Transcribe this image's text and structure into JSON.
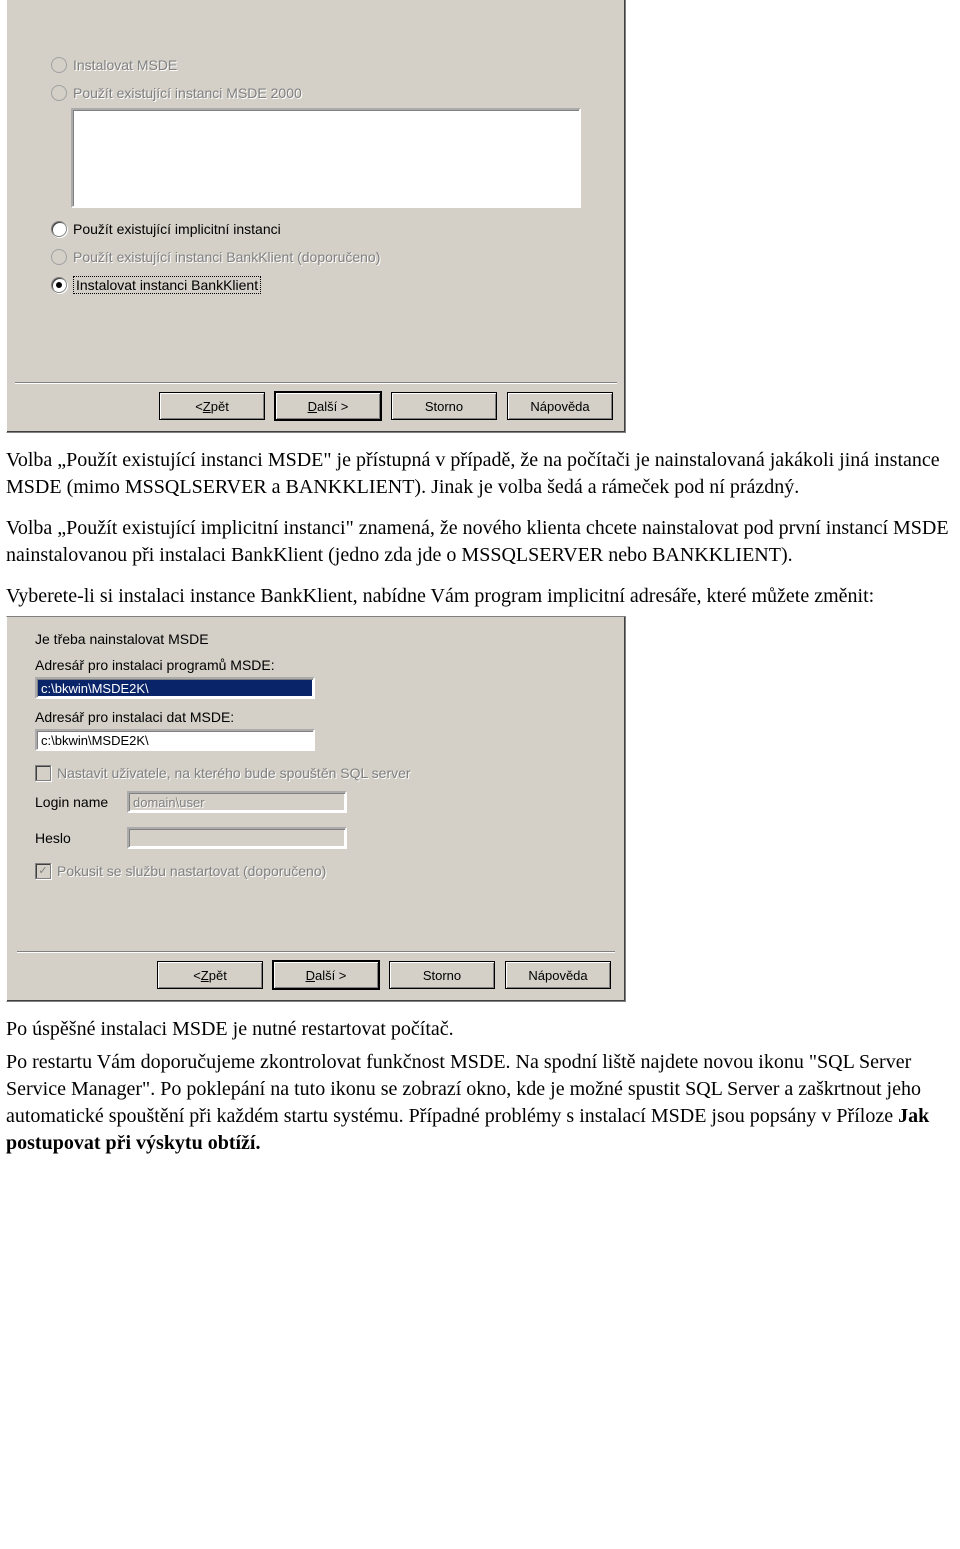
{
  "dialog1": {
    "radios": {
      "install_msde": "Instalovat MSDE",
      "use_existing_msde2000": "Použít existující instanci MSDE 2000",
      "use_implicit": "Použít existující implicitní instanci",
      "use_bankklient": "Použít existující instanci BankKlient (doporučeno)",
      "install_bankklient": "Instalovat instanci BankKlient"
    },
    "buttons": {
      "back_prefix": "< ",
      "back_u": "Z",
      "back_suffix": "pět",
      "next_u": "D",
      "next_suffix": "alší >",
      "cancel": "Storno",
      "help": "Nápověda"
    }
  },
  "body": {
    "p1": "Volba „Použít existující instanci MSDE\" je přístupná v případě, že na počítači je nainstalovaná jakákoli jiná instance MSDE (mimo MSSQLSERVER a BANKKLIENT). Jinak je volba šedá a rámeček pod ní prázdný.",
    "p2": "Volba „Použít existující implicitní instanci\" znamená, že nového klienta chcete nainstalovat pod první instancí MSDE nainstalovanou při instalaci BankKlient (jedno zda jde o MSSQLSERVER nebo BANKKLIENT).",
    "p3": "Vyberete-li si instalaci instance BankKlient, nabídne Vám program implicitní adresáře, které můžete změnit:",
    "p4": "Po úspěšné instalaci MSDE je nutné restartovat počítač.",
    "p5a": "Po restartu Vám doporučujeme zkontrolovat funkčnost MSDE. Na spodní liště najdete novou ikonu \"SQL Server Service Manager\". Po poklepání na tuto ikonu se zobrazí okno, kde je možné spustit SQL Server a zaškrtnout jeho automatické spouštění při  každém startu systému. Případné problémy s instalací MSDE jsou popsány v Příloze  ",
    "p5b": "Jak postupovat při výskytu obtíží."
  },
  "dialog2": {
    "heading": "Je třeba nainstalovat MSDE",
    "label_prog": "Adresář pro instalaci programů MSDE:",
    "val_prog": "c:\\bkwin\\MSDE2K\\",
    "label_data": "Adresář pro instalaci dat MSDE:",
    "val_data": "c:\\bkwin\\MSDE2K\\",
    "chk_user": "Nastavit uživatele, na kterého bude spouštěn SQL server",
    "login_label": "Login name",
    "login_placeholder": "domain\\user",
    "heslo_label": "Heslo",
    "chk_service": "Pokusit se službu nastartovat (doporučeno)"
  }
}
